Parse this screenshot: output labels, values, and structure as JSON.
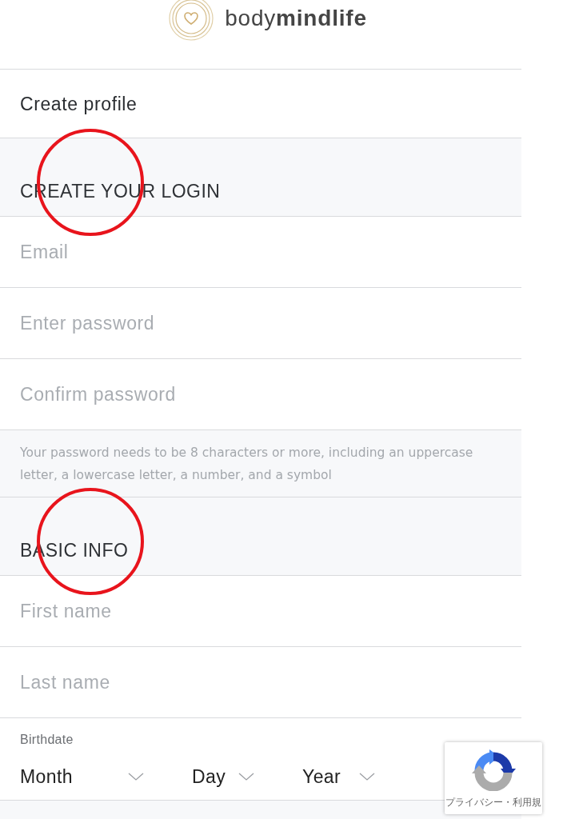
{
  "header": {
    "logo_text": "body**mindlife**"
  },
  "page_title": "Create profile",
  "sections": [
    {
      "heading": "CREATE YOUR LOGIN",
      "circled": true,
      "fields": [
        {
          "kind": "text",
          "placeholder": "Email"
        },
        {
          "kind": "text",
          "placeholder": "Enter password"
        },
        {
          "kind": "text",
          "placeholder": "Confirm password"
        },
        {
          "kind": "hint",
          "text": "Your password needs to be 8 characters or more, including an uppercase letter, a lowercase letter, a number, and a symbol"
        }
      ]
    },
    {
      "heading": "BASIC INFO",
      "circled": true,
      "fields": [
        {
          "kind": "text",
          "placeholder": "First name"
        },
        {
          "kind": "text",
          "placeholder": "Last name"
        },
        {
          "kind": "date",
          "label": "Birthdate",
          "selects": [
            "Month",
            "Day",
            "Year"
          ]
        }
      ]
    }
  ],
  "captcha_badge": {
    "text": "プライバシー・利用規"
  }
}
